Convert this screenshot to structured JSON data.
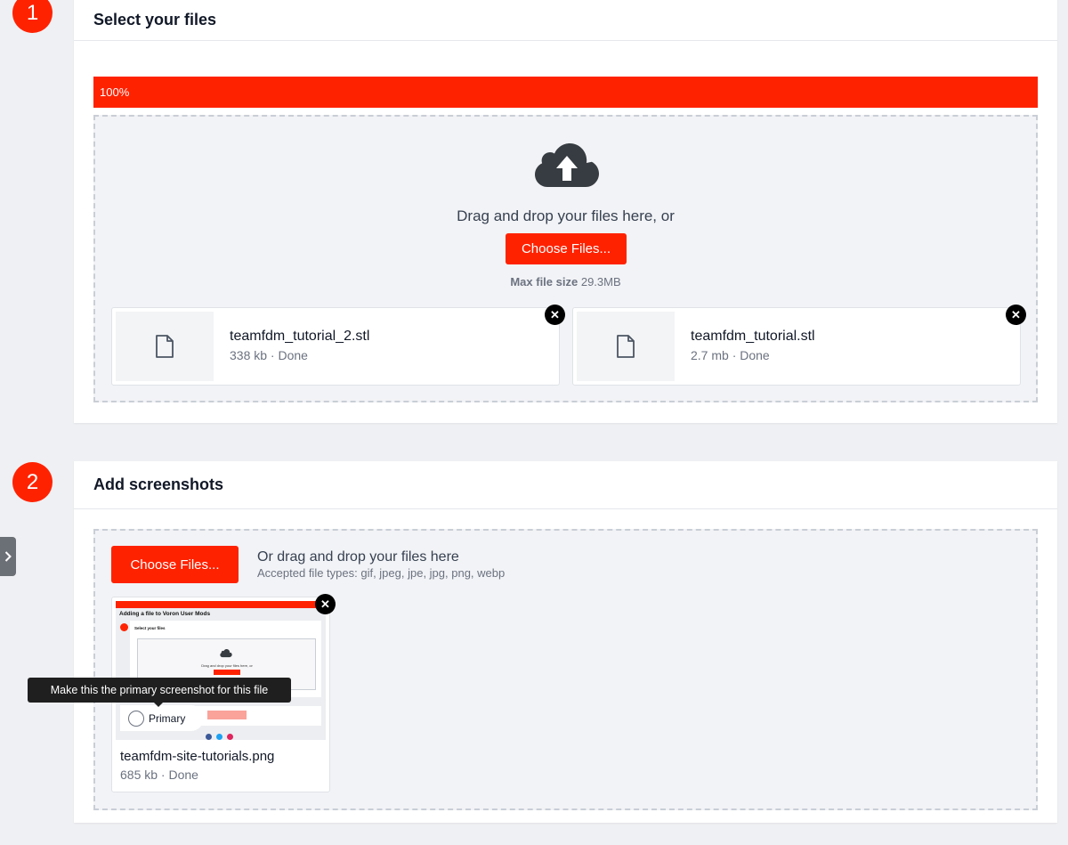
{
  "steps": [
    {
      "number": "1",
      "title": "Select your files"
    },
    {
      "number": "2",
      "title": "Add screenshots"
    }
  ],
  "upload": {
    "progress_label": "100%",
    "progress_value": 1.0,
    "drag_text": "Drag and drop your files here, or",
    "choose_label": "Choose Files...",
    "max_label": "Max file size",
    "max_value": "29.3MB",
    "files": [
      {
        "name": "teamfdm_tutorial_2.stl",
        "meta": "338 kb · Done"
      },
      {
        "name": "teamfdm_tutorial.stl",
        "meta": "2.7 mb · Done"
      }
    ]
  },
  "screenshots": {
    "choose_label": "Choose Files...",
    "or_text": "Or drag and drop your files here",
    "accepted": "Accepted file types: gif, jpeg, jpe, jpg, png, webp",
    "file": {
      "name": "teamfdm-site-tutorials.png",
      "meta": "685 kb · Done"
    },
    "primary_label": "Primary",
    "tooltip": "Make this the primary screenshot for this file",
    "thumb": {
      "title": "Adding a file to Voron User Mods",
      "select": "Select your files",
      "drag": "Drag and drop your files here, or",
      "btn": "Choose Files..."
    }
  },
  "colors": {
    "accent": "#ff2200",
    "close": "#000000"
  },
  "icons": {
    "close": "close-icon",
    "cloud": "cloud-upload-icon",
    "file": "file-icon",
    "side": "chevron-right-icon"
  }
}
